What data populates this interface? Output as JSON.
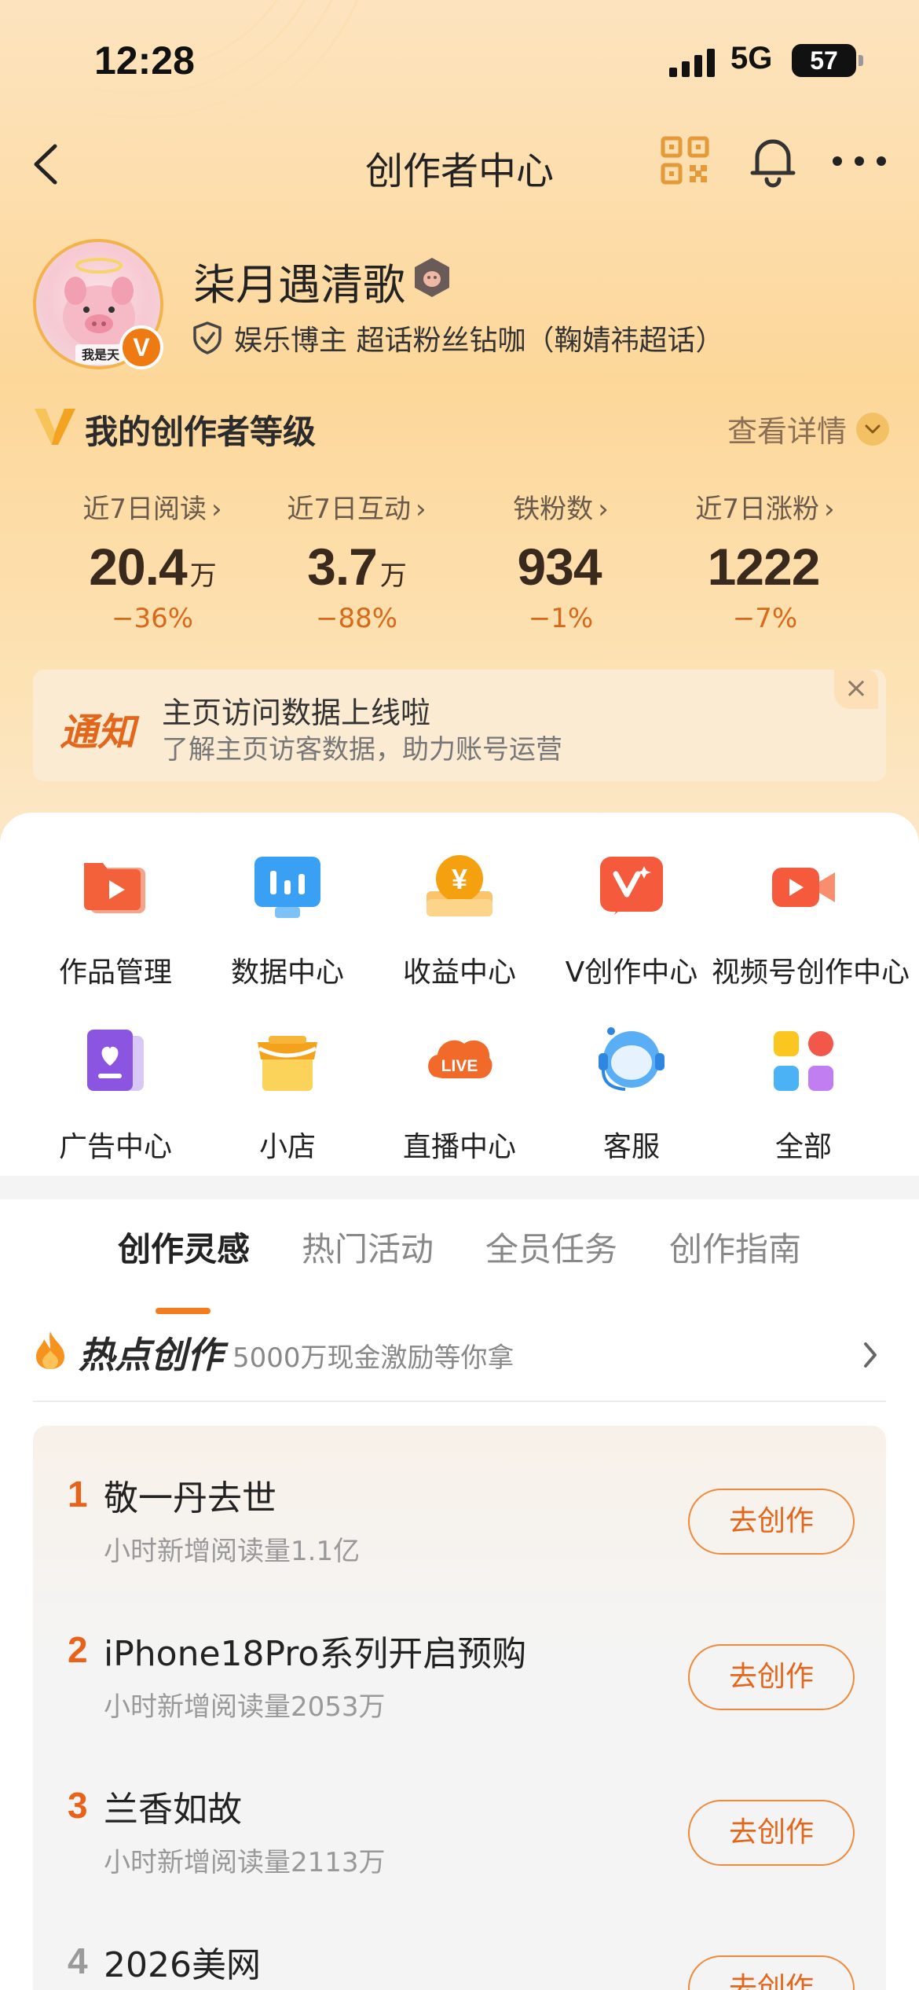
{
  "status_bar": {
    "time": "12:28",
    "network": "5G",
    "battery": "57"
  },
  "nav": {
    "title": "创作者中心"
  },
  "profile": {
    "username": "柒月遇清歌",
    "avatar_caption": "我是天",
    "verify_text": "娱乐博主 超话粉丝钻咖（鞠婧祎超话）"
  },
  "creator_level": {
    "title": "我的创作者等级",
    "detail_link": "查看详情"
  },
  "stats": [
    {
      "label": "近7日阅读",
      "value": "20.4",
      "unit": "万",
      "delta": "−36%"
    },
    {
      "label": "近7日互动",
      "value": "3.7",
      "unit": "万",
      "delta": "−88%"
    },
    {
      "label": "铁粉数",
      "value": "934",
      "unit": "",
      "delta": "−1%"
    },
    {
      "label": "近7日涨粉",
      "value": "1222",
      "unit": "",
      "delta": "−7%"
    }
  ],
  "notice": {
    "tag": "通知",
    "title": "主页访问数据上线啦",
    "subtitle": "了解主页访客数据，助力账号运营",
    "close": "×"
  },
  "tools": [
    {
      "label": "作品管理",
      "icon": "works-icon"
    },
    {
      "label": "数据中心",
      "icon": "data-icon"
    },
    {
      "label": "收益中心",
      "icon": "income-icon"
    },
    {
      "label": "V创作中心",
      "icon": "v-create-icon"
    },
    {
      "label": "视频号创作中心",
      "icon": "video-icon"
    },
    {
      "label": "广告中心",
      "icon": "ad-icon"
    },
    {
      "label": "小店",
      "icon": "shop-icon"
    },
    {
      "label": "直播中心",
      "icon": "live-icon"
    },
    {
      "label": "客服",
      "icon": "service-icon"
    },
    {
      "label": "全部",
      "icon": "all-icon"
    }
  ],
  "live_icon_text": "LIVE",
  "income_icon_text": "¥",
  "tabs": [
    "创作灵感",
    "热门活动",
    "全员任务",
    "创作指南"
  ],
  "hot": {
    "title": "热点创作",
    "subtitle": "5000万现金激励等你拿",
    "items": [
      {
        "rank": "1",
        "title": "敬一丹去世",
        "sub": "小时新增阅读量1.1亿",
        "button": "去创作"
      },
      {
        "rank": "2",
        "title": "iPhone18Pro系列开启预购",
        "sub": "小时新增阅读量2053万",
        "button": "去创作"
      },
      {
        "rank": "3",
        "title": "兰香如故",
        "sub": "小时新增阅读量2113万",
        "button": "去创作"
      },
      {
        "rank": "4",
        "title": "2026美网",
        "sub": "",
        "button": "去创作"
      }
    ]
  },
  "colors": {
    "accent": "#f57c1c",
    "rank_top": "#e8621a",
    "rank_other": "#9a9a9a"
  }
}
